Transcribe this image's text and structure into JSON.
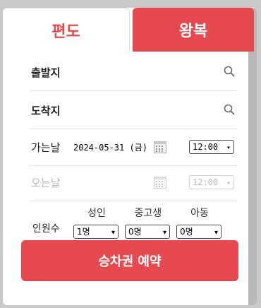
{
  "tabs": {
    "oneway_label": "편도",
    "roundtrip_label": "왕복"
  },
  "departure": {
    "label": "출발지",
    "icon": "search-icon"
  },
  "arrival": {
    "label": "도착지",
    "icon": "search-icon"
  },
  "go_date": {
    "label": "가는날",
    "value": "2024-05-31 (금)",
    "time": "12:00"
  },
  "return_date": {
    "label": "오는날",
    "time": "12:00",
    "disabled": true
  },
  "passengers": {
    "label": "인원수",
    "adult_label": "성인",
    "adult_value": "1명",
    "youth_label": "중고생",
    "youth_value": "0명",
    "child_label": "아동",
    "child_value": "0명"
  },
  "book_button": "승차권 예약",
  "colors": {
    "accent": "#e6494e",
    "background": "#c9c9c9"
  }
}
